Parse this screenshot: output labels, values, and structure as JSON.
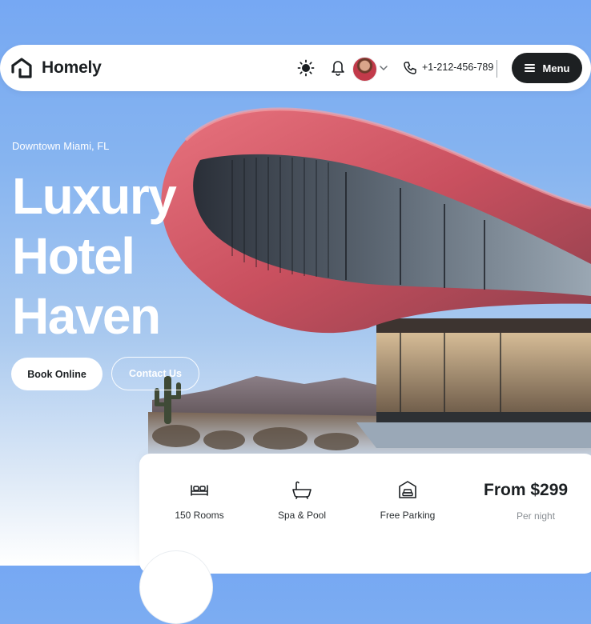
{
  "navbar": {
    "brand": "Homely",
    "phone": "+1-212-456-789",
    "menu_label": "Menu",
    "icons": [
      "home-logo-icon",
      "sun-icon",
      "bell-icon",
      "chevron-down-icon",
      "phone-icon",
      "hamburger-icon"
    ]
  },
  "hero": {
    "location": "Downtown Miami, FL",
    "title_lines": [
      "Luxury",
      "Hotel",
      "Haven"
    ],
    "book_label": "Book Online",
    "contact_label": "Contact Us"
  },
  "features": {
    "items": [
      {
        "label": "150 Rooms",
        "icon": "bed-icon"
      },
      {
        "label": "Spa & Pool",
        "icon": "bathtub-icon"
      },
      {
        "label": "Free Parking",
        "icon": "car-garage-icon"
      }
    ],
    "price": "From $299",
    "price_unit": "Per night"
  },
  "colors": {
    "sky": "#76a8f3",
    "building_pink": "#d9606e",
    "dark": "#1d2022",
    "white": "#ffffff"
  }
}
